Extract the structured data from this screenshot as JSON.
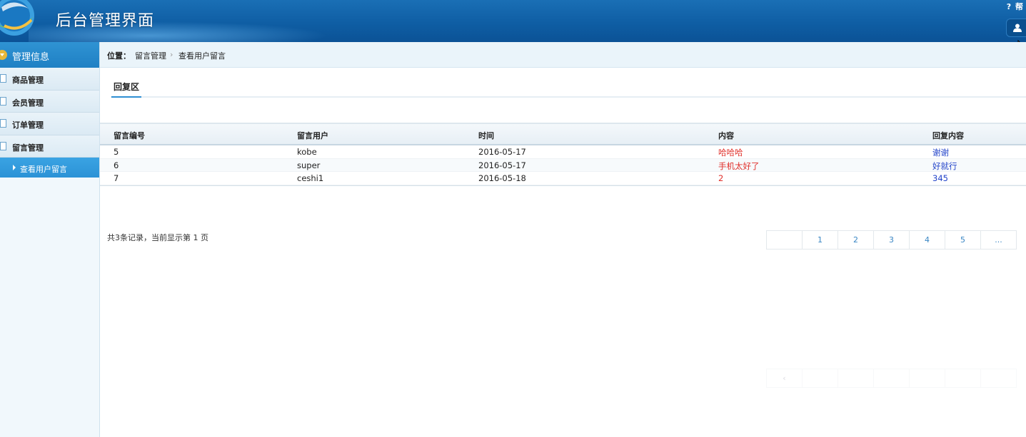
{
  "header": {
    "title": "后台管理界面",
    "help_label": "帮",
    "help_icon": "?",
    "brand_color": "#0f5ea4"
  },
  "sidebar": {
    "section_title": "管理信息",
    "items": [
      {
        "label": "商品管理"
      },
      {
        "label": "会员管理"
      },
      {
        "label": "订单管理"
      },
      {
        "label": "留言管理"
      }
    ],
    "active_sub": "查看用户留言"
  },
  "breadcrumb": {
    "prefix": "位置：",
    "level1": "留言管理",
    "separator": "›",
    "level2": "查看用户留言"
  },
  "tabs": [
    {
      "label": "回复区",
      "active": true
    }
  ],
  "table": {
    "headers": [
      "留言编号",
      "留言用户",
      "时间",
      "内容",
      "回复内容"
    ],
    "rows": [
      {
        "id": "5",
        "user": "kobe",
        "time": "2016-05-17",
        "content": "哈哈哈",
        "reply": "谢谢"
      },
      {
        "id": "6",
        "user": "super",
        "time": "2016-05-17",
        "content": "手机太好了",
        "reply": "好就行"
      },
      {
        "id": "7",
        "user": "ceshi1",
        "time": "2016-05-18",
        "content": "2",
        "reply": "345"
      }
    ],
    "content_color": "#e0302b",
    "reply_color": "#2243c9"
  },
  "footer": {
    "summary": "共3条记录，当前显示第  1 页",
    "pages": [
      "",
      "1",
      "2",
      "3",
      "4",
      "5",
      "..."
    ],
    "ghost_pages": [
      "‹",
      "",
      "",
      "",
      "",
      "",
      ""
    ]
  }
}
